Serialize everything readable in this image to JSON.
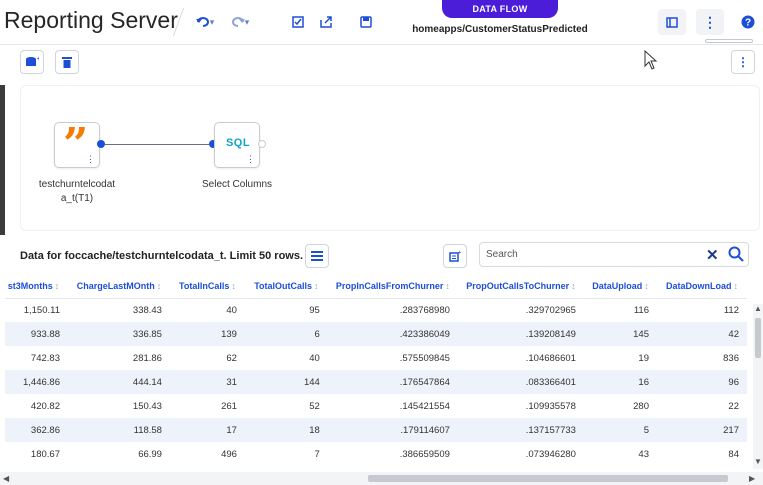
{
  "app": {
    "title": "Reporting Server"
  },
  "header": {
    "flow_tag": "DATA FLOW",
    "flow_path": "homeapps/CustomerStatusPredicted"
  },
  "canvas": {
    "nodes": [
      {
        "label_line1": "testchurntelcodat",
        "label_line2": "a_t(T1)",
        "icon": "quote-icon"
      },
      {
        "label_line1": "Select Columns",
        "icon": "sql-icon",
        "badge": "SQL"
      }
    ]
  },
  "data_panel": {
    "title": "Data for foccache/testchurntelcodata_t. Limit 50 rows.",
    "search_placeholder": "Search",
    "columns": [
      "st3Months",
      "ChargeLastMOnth",
      "TotalInCalls",
      "TotalOutCalls",
      "PropInCallsFromChurner",
      "PropOutCallsToChurner",
      "DataUpload",
      "DataDownLoad"
    ],
    "rows": [
      [
        "1,150.11",
        "338.43",
        "40",
        "95",
        ".283768980",
        ".329702965",
        "116",
        "112"
      ],
      [
        "933.88",
        "336.85",
        "139",
        "6",
        ".423386049",
        ".139208149",
        "145",
        "42"
      ],
      [
        "742.83",
        "281.86",
        "62",
        "40",
        ".575509845",
        ".104686601",
        "19",
        "836"
      ],
      [
        "1,446.86",
        "444.14",
        "31",
        "144",
        ".176547864",
        ".083366401",
        "16",
        "96"
      ],
      [
        "420.82",
        "150.43",
        "261",
        "52",
        ".145421554",
        ".109935578",
        "280",
        "22"
      ],
      [
        "362.86",
        "118.58",
        "17",
        "18",
        ".179114607",
        ".137157733",
        "5",
        "217"
      ],
      [
        "180.67",
        "66.99",
        "496",
        "7",
        ".386659509",
        ".073946280",
        "43",
        "84"
      ]
    ]
  },
  "colors": {
    "accent": "#1d4ed8",
    "flow_tag_bg": "#4c1dd9",
    "row_alt": "#edf2fb",
    "node_quote": "#f57c00",
    "node_sql": "#0ea5c4"
  }
}
